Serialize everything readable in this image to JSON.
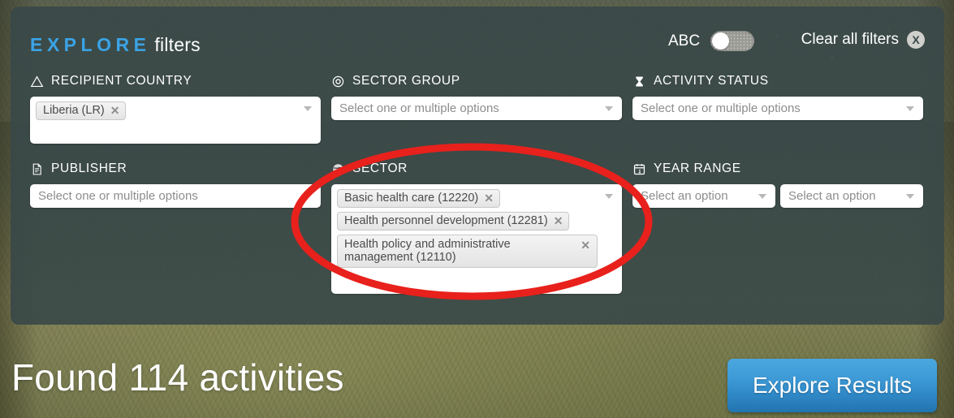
{
  "header": {
    "brand_explore": "EXPLORE",
    "brand_filters": "filters",
    "abc_label": "ABC",
    "abc_toggle_state": "off",
    "clear_all_label": "Clear all filters",
    "clear_all_icon_glyph": "X"
  },
  "filters": {
    "recipient_country": {
      "label": "RECIPIENT COUNTRY",
      "icon": "triangle-outline-icon",
      "chips": [
        "Liberia (LR)"
      ],
      "chip_remove_glyph": "✕",
      "caret_glyph": "▼"
    },
    "sector_group": {
      "label": "SECTOR GROUP",
      "icon": "target-circle-icon",
      "placeholder": "Select one or multiple options",
      "value": ""
    },
    "activity_status": {
      "label": "ACTIVITY STATUS",
      "icon": "hourglass-icon",
      "placeholder": "Select one or multiple options",
      "value": ""
    },
    "publisher": {
      "label": "PUBLISHER",
      "icon": "document-icon",
      "placeholder": "Select one or multiple options",
      "value": ""
    },
    "sector": {
      "label": "SECTOR",
      "icon": "globe-icon",
      "chips": [
        "Basic health care (12220)",
        "Health personnel development (12281)",
        "Health policy and administrative management (12110)"
      ],
      "chip_remove_glyph": "✕"
    },
    "year_range": {
      "label": "YEAR RANGE",
      "icon": "calendar-icon",
      "from_placeholder": "Select an option",
      "to_placeholder": "Select an option",
      "from_value": "",
      "to_value": ""
    }
  },
  "footer": {
    "found_text": "Found 114 activities",
    "found_count": 114,
    "explore_button_label": "Explore Results"
  },
  "annotation": {
    "shape": "ellipse",
    "color": "#e8211c",
    "target": "sector-filter"
  },
  "colors": {
    "brand_blue": "#3aa3e6",
    "panel_bg": "#394848",
    "button_blue": "#3d9ad6",
    "annotation_red": "#e8211c"
  }
}
